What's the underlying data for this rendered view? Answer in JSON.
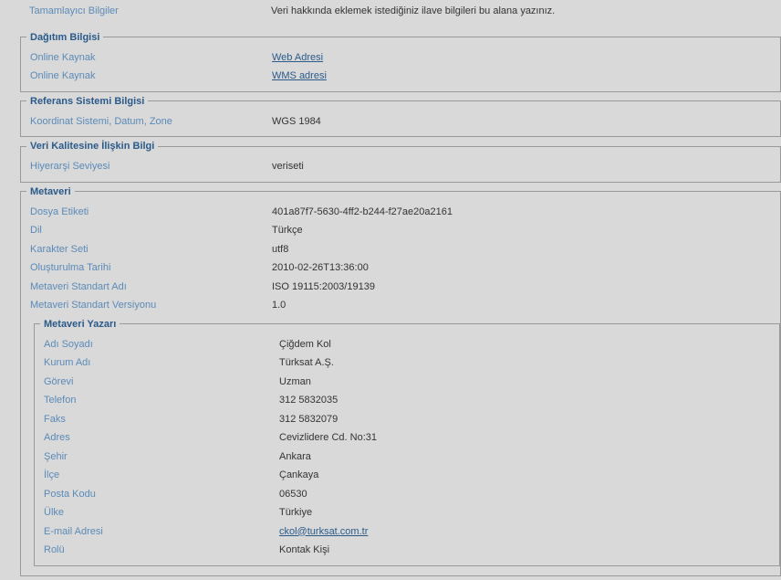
{
  "top": {
    "compInfoLabel": "Tamamlayıcı Bilgiler",
    "compInfoValue": "Veri hakkında eklemek istediğiniz ilave bilgileri bu alana yazınız."
  },
  "distribution": {
    "legend": "Dağıtım Bilgisi",
    "row1Label": "Online Kaynak",
    "row1Link": "Web Adresi",
    "row2Label": "Online Kaynak",
    "row2Link": "WMS adresi"
  },
  "refsys": {
    "legend": "Referans Sistemi Bilgisi",
    "label": "Koordinat Sistemi, Datum, Zone",
    "value": "WGS 1984"
  },
  "quality": {
    "legend": "Veri Kalitesine İlişkin Bilgi",
    "label": "Hiyerarşi Seviyesi",
    "value": "veriseti"
  },
  "metadata": {
    "legend": "Metaveri",
    "fileLabel": "Dosya Etiketi",
    "fileValue": "401a87f7-5630-4ff2-b244-f27ae20a2161",
    "langLabel": "Dil",
    "langValue": "Türkçe",
    "charsetLabel": "Karakter Seti",
    "charsetValue": "utf8",
    "createdLabel": "Oluşturulma Tarihi",
    "createdValue": "2010-02-26T13:36:00",
    "stdNameLabel": "Metaveri Standart Adı",
    "stdNameValue": "ISO 19115:2003/19139",
    "stdVerLabel": "Metaveri Standart Versiyonu",
    "stdVerValue": "1.0"
  },
  "author": {
    "legend": "Metaveri Yazarı",
    "nameLabel": "Adı Soyadı",
    "nameValue": "Çiğdem Kol",
    "orgLabel": "Kurum Adı",
    "orgValue": "Türksat A.Ş.",
    "positionLabel": "Görevi",
    "positionValue": "Uzman",
    "phoneLabel": "Telefon",
    "phoneValue": "312 5832035",
    "faxLabel": "Faks",
    "faxValue": "312 5832079",
    "addrLabel": "Adres",
    "addrValue": "Cevizlidere Cd. No:31",
    "cityLabel": "Şehir",
    "cityValue": "Ankara",
    "districtLabel": "İlçe",
    "districtValue": "Çankaya",
    "postalLabel": "Posta Kodu",
    "postalValue": "06530",
    "countryLabel": "Ülke",
    "countryValue": "Türkiye",
    "emailLabel": "E-mail Adresi",
    "emailValue": "ckol@turksat.com.tr",
    "roleLabel": "Rolü",
    "roleValue": "Kontak Kişi"
  }
}
